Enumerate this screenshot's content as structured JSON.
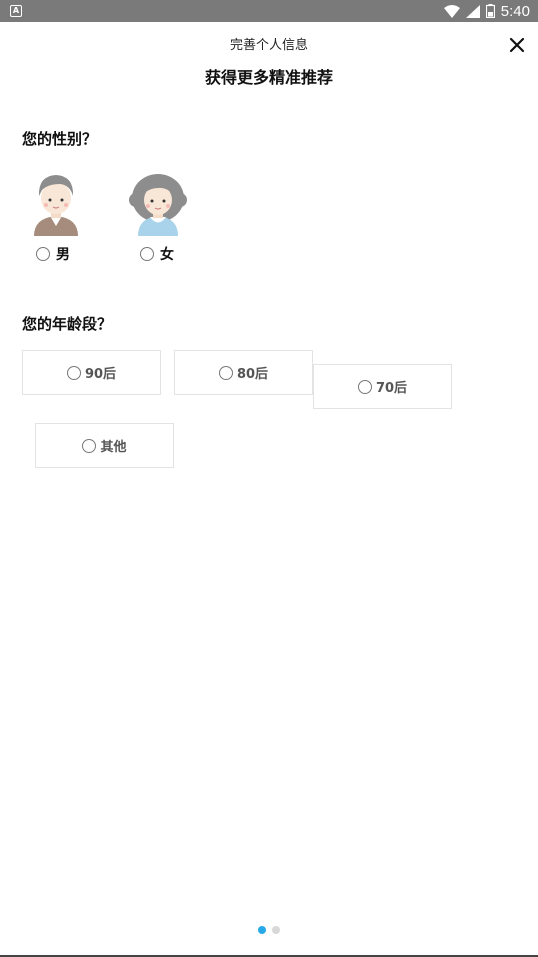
{
  "status_bar": {
    "time": "5:40",
    "notification_glyph": "A",
    "icons": [
      "wifi-icon",
      "signal-icon",
      "battery-icon"
    ]
  },
  "header": {
    "title": "完善个人信息",
    "subtitle": "获得更多精准推荐",
    "close_icon": "close-icon"
  },
  "gender": {
    "question": "您的性别？",
    "options": [
      {
        "label": "男",
        "icon": "male-avatar-icon",
        "selected": false
      },
      {
        "label": "女",
        "icon": "female-avatar-icon",
        "selected": false
      }
    ]
  },
  "age": {
    "question": "您的年龄段？",
    "options": [
      {
        "label": "90后",
        "selected": false
      },
      {
        "label": "80后",
        "selected": false
      },
      {
        "label": "70后",
        "selected": false
      },
      {
        "label": "其他",
        "selected": false
      }
    ]
  },
  "pager": {
    "pages": 2,
    "current": 1
  },
  "colors": {
    "accent": "#29a8e8",
    "status_bar": "#7a7a7a",
    "border": "#e3e3e3"
  }
}
